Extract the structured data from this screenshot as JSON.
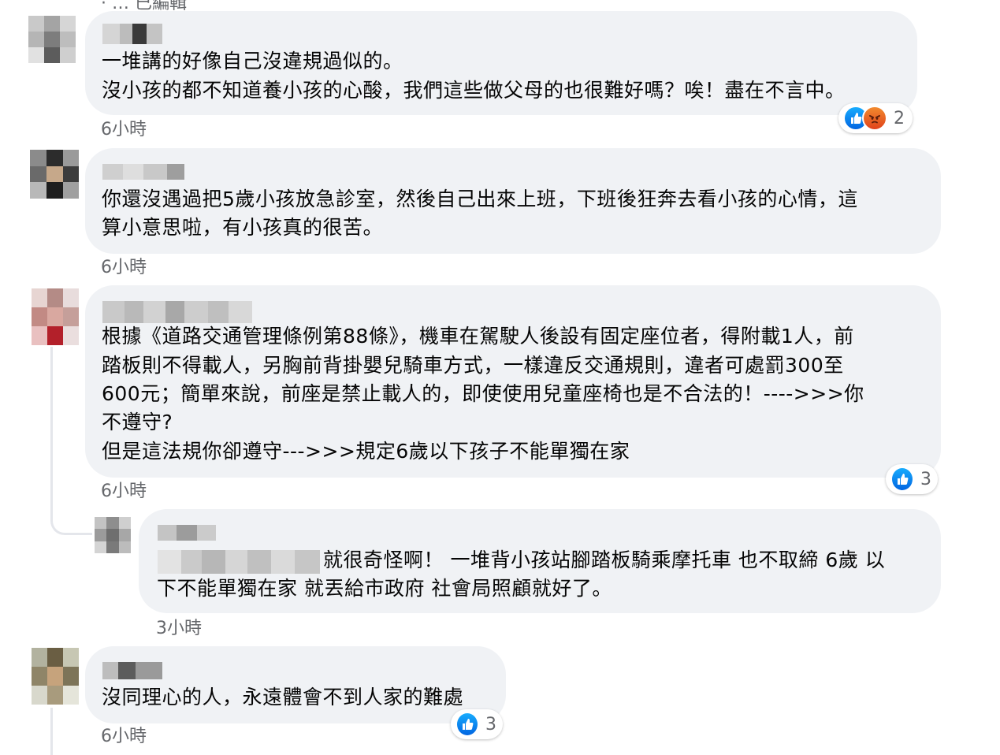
{
  "top_fragment": "·  …  已編輯",
  "comments": [
    {
      "lines": [
        "一堆講的好像自己沒違規過似的。",
        "沒小孩的都不知道養小孩的心酸，我們這些做父母的也很難好嗎？唉！盡在不言中。"
      ],
      "time": "6小時",
      "reaction_count": "2",
      "reaction_icons": [
        "like-icon",
        "angry-icon"
      ]
    },
    {
      "lines": [
        "你還沒遇過把5歲小孩放急診室，然後自己出來上班，下班後狂奔去看小孩的心情，這",
        "算小意思啦，有小孩真的很苦。"
      ],
      "time": "6小時"
    },
    {
      "lines": [
        "根據《道路交通管理條例第88條》，機車在駕駛人後設有固定座位者，得附載1人，前",
        "踏板則不得載人，另胸前背掛嬰兒騎車方式，一樣違反交通規則，違者可處罰300至",
        "600元；簡單來說，前座是禁止載人的，即使使用兒童座椅也是不合法的！---->>>你",
        "不遵守?",
        "但是這法規你卻遵守--->>>規定6歲以下孩子不能單獨在家"
      ],
      "time": "6小時",
      "reaction_count": "3",
      "reaction_icons": [
        "like-icon"
      ]
    },
    {
      "lines": [
        "就很奇怪啊！ 一堆背小孩站腳踏板騎乘摩托車 也不取締 6歲 以",
        "下不能單獨在家 就丟給市政府 社會局照顧就好了。"
      ],
      "time": "3小時"
    },
    {
      "lines": [
        "沒同理心的人，永遠體會不到人家的難處"
      ],
      "time": "6小時",
      "reaction_count": "3",
      "reaction_icons": [
        "like-icon"
      ]
    }
  ],
  "colors": {
    "bubble": "#f0f2f5",
    "time_text": "#65676b",
    "like_blue": "#0866ff",
    "angry_orange": "#e8561f",
    "thread_line": "#e4e6eb"
  }
}
